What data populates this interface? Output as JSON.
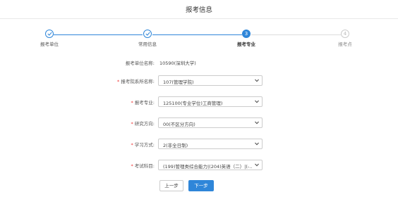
{
  "header": {
    "title": "报考信息"
  },
  "steps": [
    {
      "label": "报考单位",
      "state": "done",
      "number": ""
    },
    {
      "label": "常用信息",
      "state": "done",
      "number": ""
    },
    {
      "label": "报考专业",
      "state": "active",
      "number": "3"
    },
    {
      "label": "报考点",
      "state": "todo",
      "number": "4"
    }
  ],
  "form": {
    "unit": {
      "label": "报考单位名称:",
      "value": "10590(深圳大学)"
    },
    "department": {
      "label": "报考院系所名称:",
      "value": "107(管理学院)"
    },
    "major": {
      "label": "报考专业:",
      "value": "125100(专业学位)工商管理)"
    },
    "direction": {
      "label": "研究方向:",
      "value": "00(不区分方向)"
    },
    "study_mode": {
      "label": "学习方式:",
      "value": "2(非全日制)"
    },
    "subjects": {
      "label": "考试科目:",
      "value": "(199)管理类综合能力|(204)英语（二）|(-..."
    },
    "required_mark": "*"
  },
  "buttons": {
    "prev": "上一步",
    "next": "下一步"
  },
  "colors": {
    "accent": "#2f86d9",
    "required": "#e33333"
  }
}
